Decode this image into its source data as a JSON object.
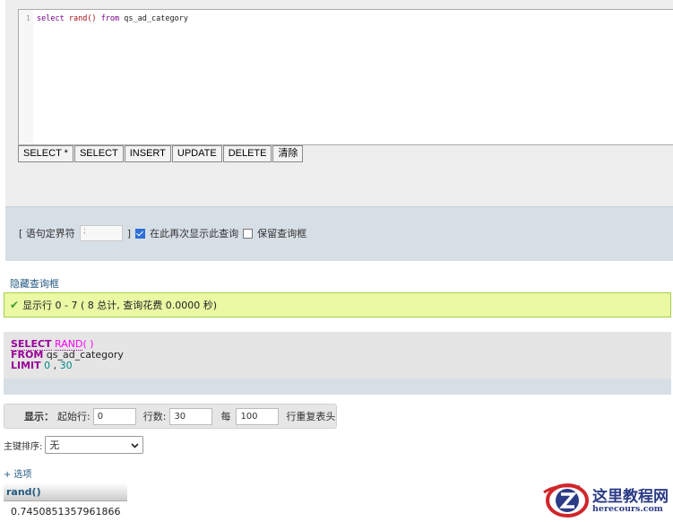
{
  "editor": {
    "line_number": "1",
    "sql_tokens": {
      "select": "select",
      "func": "rand()",
      "from": "from",
      "table": "qs_ad_category"
    },
    "buttons": [
      "SELECT *",
      "SELECT",
      "INSERT",
      "UPDATE",
      "DELETE",
      "清除"
    ]
  },
  "delimiter": {
    "label_open": "[ 语句定界符",
    "value": ";",
    "label_close": "]",
    "show_again_label": "在此再次显示此查询",
    "show_again_checked": true,
    "keep_box_label": "保留查询框",
    "keep_box_checked": false
  },
  "hide_query_link": "隐藏查询框",
  "success_message": "显示行 0 - 7 ( 8 总计, 查询花费 0.0000 秒)",
  "formatted_sql": {
    "select_kw": "SELECT",
    "rand_fn": "RAND",
    "paren": "( )",
    "from_kw": "FROM",
    "table": "qs_ad_category",
    "limit_kw": "LIMIT",
    "limit_start": "0",
    "limit_sep": ",",
    "limit_count": "30"
  },
  "navigation": {
    "show_label": "显示：",
    "start_label": "起始行:",
    "start_value": "0",
    "rows_label": "行数:",
    "rows_value": "30",
    "every_label": "每",
    "every_value": "100",
    "repeat_header_label": "行重复表头"
  },
  "sort": {
    "label": "主键排序:",
    "selected": "无"
  },
  "options_link": "+ 选项",
  "results": {
    "columns": [
      "rand()"
    ],
    "rows": [
      [
        "0.7450851357961866"
      ]
    ]
  },
  "watermark": {
    "cn": "这里教程网",
    "url": "herecours.com",
    "colors": {
      "red": "#d0262b",
      "blue": "#2c3b86"
    }
  }
}
